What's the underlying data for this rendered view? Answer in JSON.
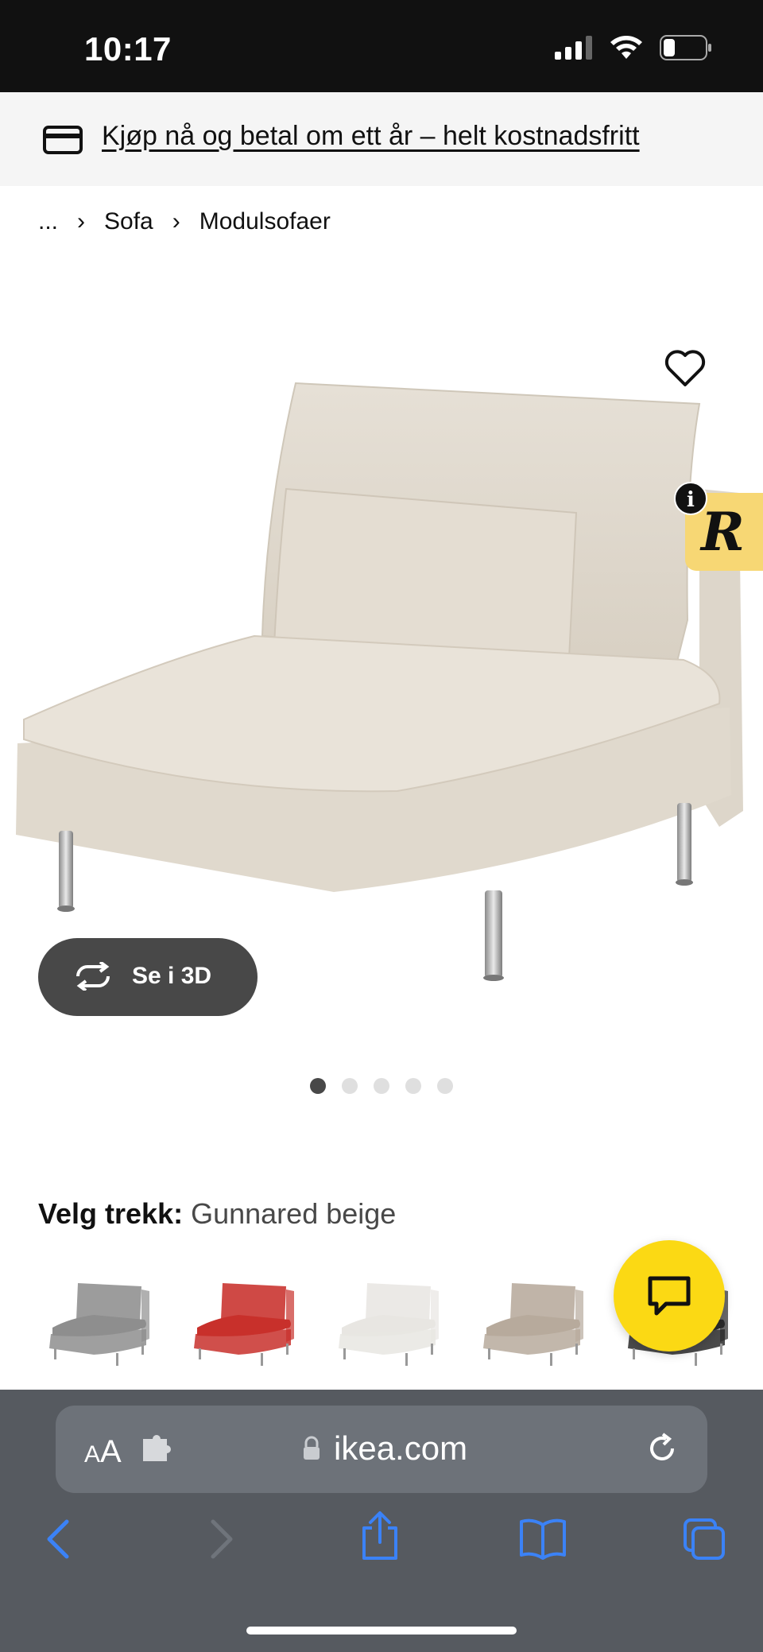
{
  "status_bar": {
    "time": "10:17"
  },
  "promo": {
    "text": "Kjøp nå og betal om ett år – helt kostnadsfritt",
    "icon": "credit-card-icon"
  },
  "breadcrumb": {
    "items": [
      "...",
      "Sofa",
      "Modulsofaer"
    ]
  },
  "product": {
    "image_alt": "sofa-chair-beige",
    "view_3d_label": "Se i 3D",
    "carousel_count": 5,
    "carousel_active": 1
  },
  "variant": {
    "label": "Velg trekk:",
    "value": "Gunnared beige",
    "swatches": [
      {
        "name": "grey",
        "color": "#8e8e8e"
      },
      {
        "name": "red",
        "color": "#c8302b"
      },
      {
        "name": "white",
        "color": "#e8e6e2"
      },
      {
        "name": "beige",
        "color": "#b7aa9c"
      },
      {
        "name": "black",
        "color": "#2b2b2b"
      }
    ]
  },
  "browser": {
    "aa_label_small": "A",
    "aa_label_large": "A",
    "url": "ikea.com"
  },
  "colors": {
    "status_bar": "#111111",
    "chat_button": "#fbd914",
    "browser_bar": "#565a60",
    "safari_blue": "#3b82f6"
  }
}
